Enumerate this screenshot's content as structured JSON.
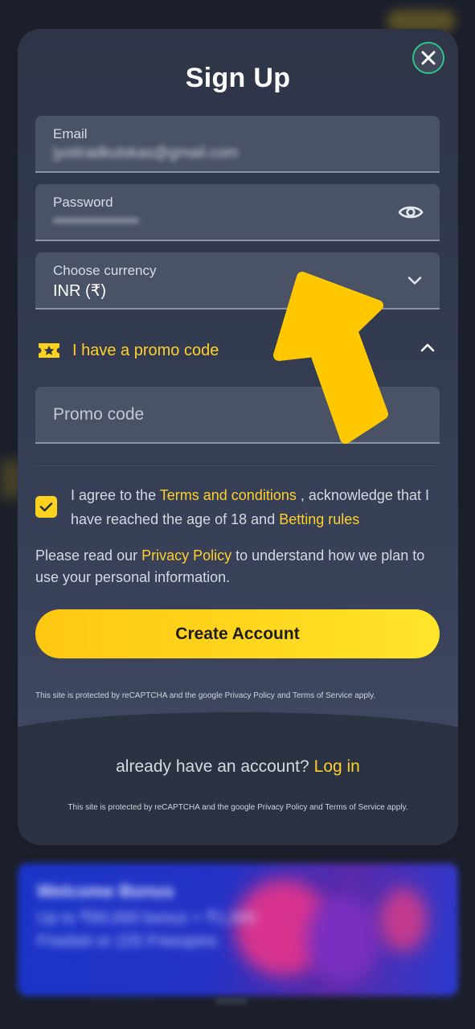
{
  "background": {
    "banner_title": "Welcome Bonus",
    "banner_text": "Up to ₹80,000 bonus + ₹1,000 Freebet or 225 Freespins"
  },
  "modal": {
    "title": "Sign Up",
    "close_icon": "close-icon"
  },
  "fields": {
    "email": {
      "label": "Email",
      "value": "jyotiradkulskas@gmail.com"
    },
    "password": {
      "label": "Password",
      "value": "••••••••••••••••",
      "icon": "eye-icon"
    },
    "currency": {
      "label": "Choose currency",
      "value": "INR (₹)",
      "icon": "chevron-down-icon"
    },
    "promo": {
      "placeholder": "Promo code"
    }
  },
  "promo_toggle": {
    "label": "I have a promo code",
    "icon": "ticket-star-icon",
    "chevron": "chevron-up-icon"
  },
  "agreement": {
    "checked": true,
    "text_1": "I agree to the ",
    "terms_link": "Terms and conditions",
    "text_2": " , acknowledge that I have reached the age of 18 and ",
    "betting_link": "Betting rules"
  },
  "privacy": {
    "text_1": "Please read our ",
    "link": "Privacy Policy",
    "text_2": " to understand how we plan to use your personal information."
  },
  "create_button": "Create Account",
  "recaptcha_note": "This site is protected by reCAPTCHA and the google Privacy Policy and Terms of Service apply.",
  "footer": {
    "question": "already have an account?",
    "login_link": "Log in",
    "recaptcha_note": "This site is protected by reCAPTCHA and the google Privacy Policy and Terms of Service apply."
  },
  "colors": {
    "accent_yellow": "#ffd02b",
    "modal_bg": "#343c52",
    "close_ring": "#2ec28f",
    "annotation_arrow": "#ffc800"
  }
}
